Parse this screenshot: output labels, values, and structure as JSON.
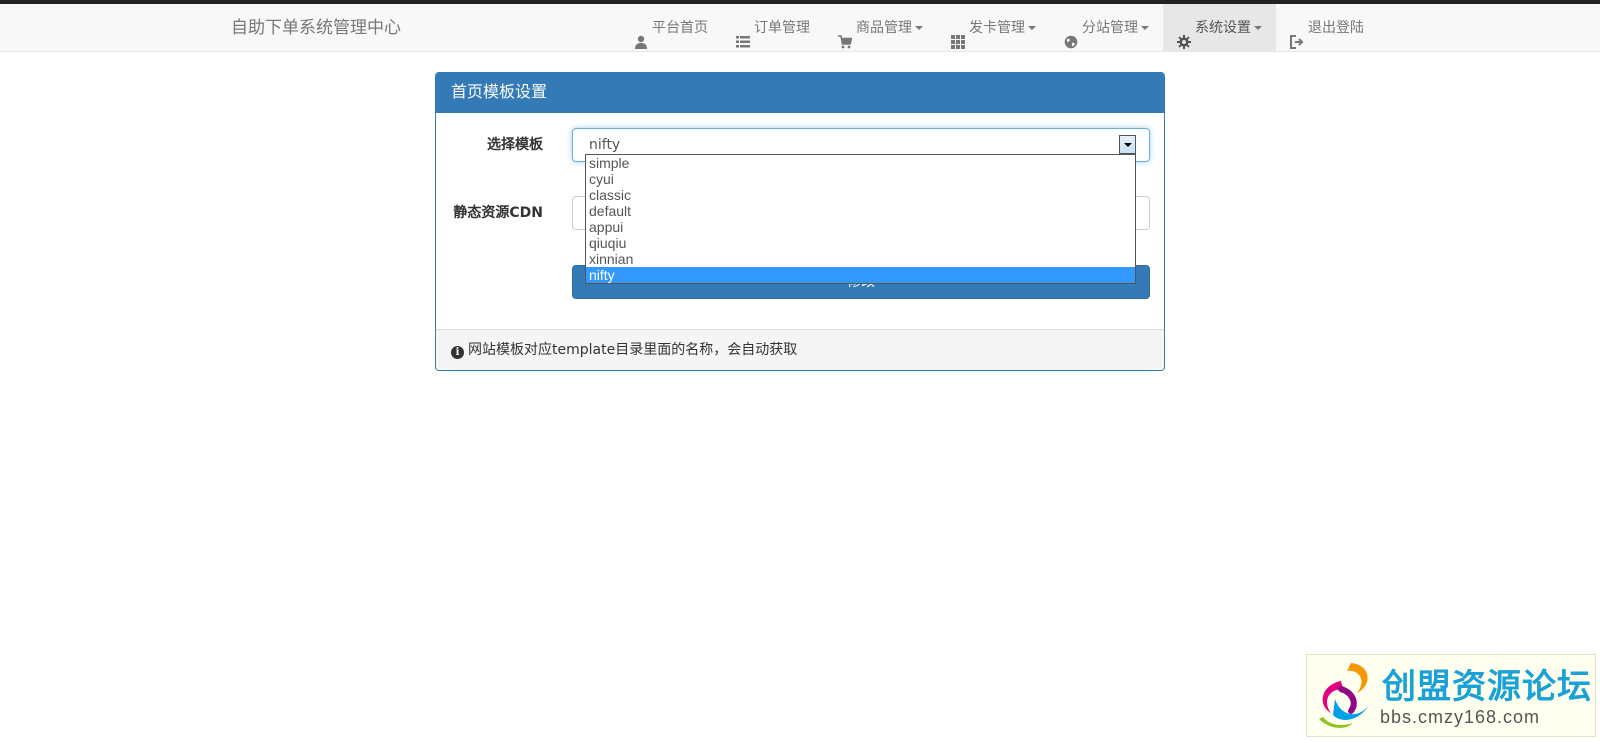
{
  "navbar": {
    "brand": "自助下单系统管理中心",
    "items": [
      {
        "label": "平台首页",
        "icon": "user-icon",
        "dropdown": false
      },
      {
        "label": "订单管理",
        "icon": "list-icon",
        "dropdown": false
      },
      {
        "label": "商品管理",
        "icon": "cart-icon",
        "dropdown": true
      },
      {
        "label": "发卡管理",
        "icon": "grid-icon",
        "dropdown": true
      },
      {
        "label": "分站管理",
        "icon": "globe-icon",
        "dropdown": true
      },
      {
        "label": "系统设置",
        "icon": "gear-icon",
        "dropdown": true,
        "active": true
      },
      {
        "label": "退出登陆",
        "icon": "logout-icon",
        "dropdown": false
      }
    ]
  },
  "panel": {
    "title": "首页模板设置",
    "template_label": "选择模板",
    "template_value": "nifty",
    "cdn_label": "静态资源CDN",
    "submit_label": "修改",
    "footer_note": "网站模板对应template目录里面的名称，会自动获取"
  },
  "dropdown": {
    "options": [
      "simple",
      "cyui",
      "classic",
      "default",
      "appui",
      "qiuqiu",
      "xinnian",
      "nifty"
    ],
    "selected": "nifty"
  },
  "watermark": {
    "title": "创盟资源论坛",
    "url": "bbs.cmzy168.com"
  },
  "colors": {
    "primary": "#337ab7",
    "highlight": "#3399ff",
    "navbar_bg": "#f8f8f8"
  }
}
